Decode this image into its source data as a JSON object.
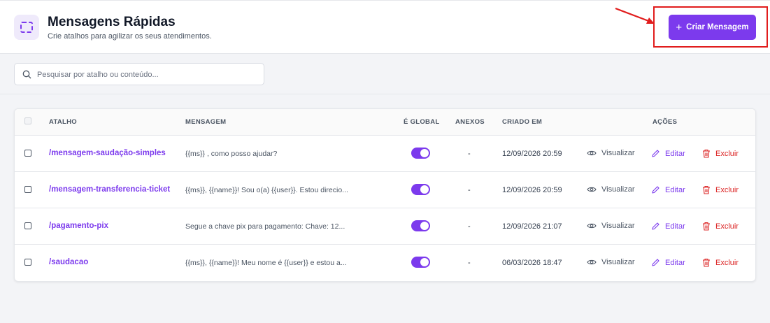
{
  "header": {
    "icon": "dashed-square-icon",
    "title": "Mensagens Rápidas",
    "subtitle": "Crie atalhos para agilizar os seus atendimentos.",
    "create_label": "Criar Mensagem",
    "create_icon": "plus-icon"
  },
  "search": {
    "placeholder": "Pesquisar por atalho ou conteúdo...",
    "value": ""
  },
  "table": {
    "columns": {
      "shortcut": "ATALHO",
      "message": "MENSAGEM",
      "global": "É GLOBAL",
      "attachments": "ANEXOS",
      "created": "CRIADO EM",
      "actions": "AÇÕES"
    },
    "actions": {
      "view": "Visualizar",
      "edit": "Editar",
      "delete": "Excluir"
    },
    "rows": [
      {
        "shortcut": "/mensagem-saudação-simples",
        "message": "{{ms}} , como posso ajudar?",
        "global": true,
        "attachments": "-",
        "created": "12/09/2026 20:59"
      },
      {
        "shortcut": "/mensagem-transferencia-ticket",
        "message": "{{ms}}, {{name}}! Sou o(a) {{user}}. Estou direcio...",
        "global": true,
        "attachments": "-",
        "created": "12/09/2026 20:59"
      },
      {
        "shortcut": "/pagamento-pix",
        "message": "Segue a chave pix para pagamento: Chave: 12...",
        "global": true,
        "attachments": "-",
        "created": "12/09/2026 21:07"
      },
      {
        "shortcut": "/saudacao",
        "message": "{{ms}}, {{name}}! Meu nome é {{user}} e estou a...",
        "global": true,
        "attachments": "-",
        "created": "06/03/2026 18:47"
      }
    ]
  },
  "colors": {
    "accent": "#7c3aed",
    "danger": "#dc2626",
    "highlight": "#e11d1d"
  }
}
